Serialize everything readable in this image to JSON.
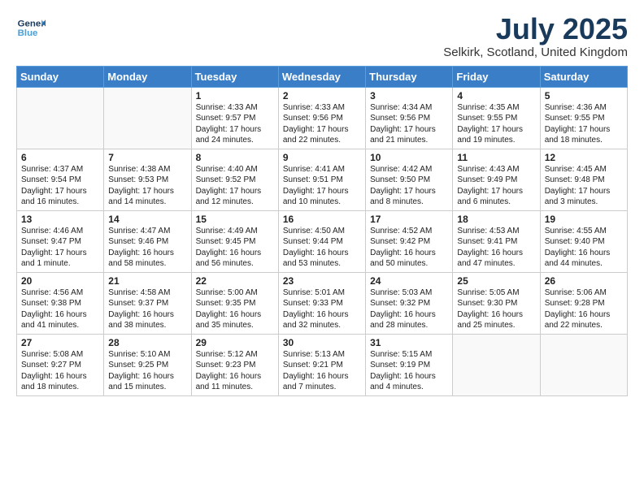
{
  "logo": {
    "line1": "General",
    "line2": "Blue"
  },
  "title": {
    "month_year": "July 2025",
    "location": "Selkirk, Scotland, United Kingdom"
  },
  "headers": [
    "Sunday",
    "Monday",
    "Tuesday",
    "Wednesday",
    "Thursday",
    "Friday",
    "Saturday"
  ],
  "weeks": [
    [
      {
        "day": "",
        "info": ""
      },
      {
        "day": "",
        "info": ""
      },
      {
        "day": "1",
        "info": "Sunrise: 4:33 AM\nSunset: 9:57 PM\nDaylight: 17 hours and 24 minutes."
      },
      {
        "day": "2",
        "info": "Sunrise: 4:33 AM\nSunset: 9:56 PM\nDaylight: 17 hours and 22 minutes."
      },
      {
        "day": "3",
        "info": "Sunrise: 4:34 AM\nSunset: 9:56 PM\nDaylight: 17 hours and 21 minutes."
      },
      {
        "day": "4",
        "info": "Sunrise: 4:35 AM\nSunset: 9:55 PM\nDaylight: 17 hours and 19 minutes."
      },
      {
        "day": "5",
        "info": "Sunrise: 4:36 AM\nSunset: 9:55 PM\nDaylight: 17 hours and 18 minutes."
      }
    ],
    [
      {
        "day": "6",
        "info": "Sunrise: 4:37 AM\nSunset: 9:54 PM\nDaylight: 17 hours and 16 minutes."
      },
      {
        "day": "7",
        "info": "Sunrise: 4:38 AM\nSunset: 9:53 PM\nDaylight: 17 hours and 14 minutes."
      },
      {
        "day": "8",
        "info": "Sunrise: 4:40 AM\nSunset: 9:52 PM\nDaylight: 17 hours and 12 minutes."
      },
      {
        "day": "9",
        "info": "Sunrise: 4:41 AM\nSunset: 9:51 PM\nDaylight: 17 hours and 10 minutes."
      },
      {
        "day": "10",
        "info": "Sunrise: 4:42 AM\nSunset: 9:50 PM\nDaylight: 17 hours and 8 minutes."
      },
      {
        "day": "11",
        "info": "Sunrise: 4:43 AM\nSunset: 9:49 PM\nDaylight: 17 hours and 6 minutes."
      },
      {
        "day": "12",
        "info": "Sunrise: 4:45 AM\nSunset: 9:48 PM\nDaylight: 17 hours and 3 minutes."
      }
    ],
    [
      {
        "day": "13",
        "info": "Sunrise: 4:46 AM\nSunset: 9:47 PM\nDaylight: 17 hours and 1 minute."
      },
      {
        "day": "14",
        "info": "Sunrise: 4:47 AM\nSunset: 9:46 PM\nDaylight: 16 hours and 58 minutes."
      },
      {
        "day": "15",
        "info": "Sunrise: 4:49 AM\nSunset: 9:45 PM\nDaylight: 16 hours and 56 minutes."
      },
      {
        "day": "16",
        "info": "Sunrise: 4:50 AM\nSunset: 9:44 PM\nDaylight: 16 hours and 53 minutes."
      },
      {
        "day": "17",
        "info": "Sunrise: 4:52 AM\nSunset: 9:42 PM\nDaylight: 16 hours and 50 minutes."
      },
      {
        "day": "18",
        "info": "Sunrise: 4:53 AM\nSunset: 9:41 PM\nDaylight: 16 hours and 47 minutes."
      },
      {
        "day": "19",
        "info": "Sunrise: 4:55 AM\nSunset: 9:40 PM\nDaylight: 16 hours and 44 minutes."
      }
    ],
    [
      {
        "day": "20",
        "info": "Sunrise: 4:56 AM\nSunset: 9:38 PM\nDaylight: 16 hours and 41 minutes."
      },
      {
        "day": "21",
        "info": "Sunrise: 4:58 AM\nSunset: 9:37 PM\nDaylight: 16 hours and 38 minutes."
      },
      {
        "day": "22",
        "info": "Sunrise: 5:00 AM\nSunset: 9:35 PM\nDaylight: 16 hours and 35 minutes."
      },
      {
        "day": "23",
        "info": "Sunrise: 5:01 AM\nSunset: 9:33 PM\nDaylight: 16 hours and 32 minutes."
      },
      {
        "day": "24",
        "info": "Sunrise: 5:03 AM\nSunset: 9:32 PM\nDaylight: 16 hours and 28 minutes."
      },
      {
        "day": "25",
        "info": "Sunrise: 5:05 AM\nSunset: 9:30 PM\nDaylight: 16 hours and 25 minutes."
      },
      {
        "day": "26",
        "info": "Sunrise: 5:06 AM\nSunset: 9:28 PM\nDaylight: 16 hours and 22 minutes."
      }
    ],
    [
      {
        "day": "27",
        "info": "Sunrise: 5:08 AM\nSunset: 9:27 PM\nDaylight: 16 hours and 18 minutes."
      },
      {
        "day": "28",
        "info": "Sunrise: 5:10 AM\nSunset: 9:25 PM\nDaylight: 16 hours and 15 minutes."
      },
      {
        "day": "29",
        "info": "Sunrise: 5:12 AM\nSunset: 9:23 PM\nDaylight: 16 hours and 11 minutes."
      },
      {
        "day": "30",
        "info": "Sunrise: 5:13 AM\nSunset: 9:21 PM\nDaylight: 16 hours and 7 minutes."
      },
      {
        "day": "31",
        "info": "Sunrise: 5:15 AM\nSunset: 9:19 PM\nDaylight: 16 hours and 4 minutes."
      },
      {
        "day": "",
        "info": ""
      },
      {
        "day": "",
        "info": ""
      }
    ]
  ]
}
